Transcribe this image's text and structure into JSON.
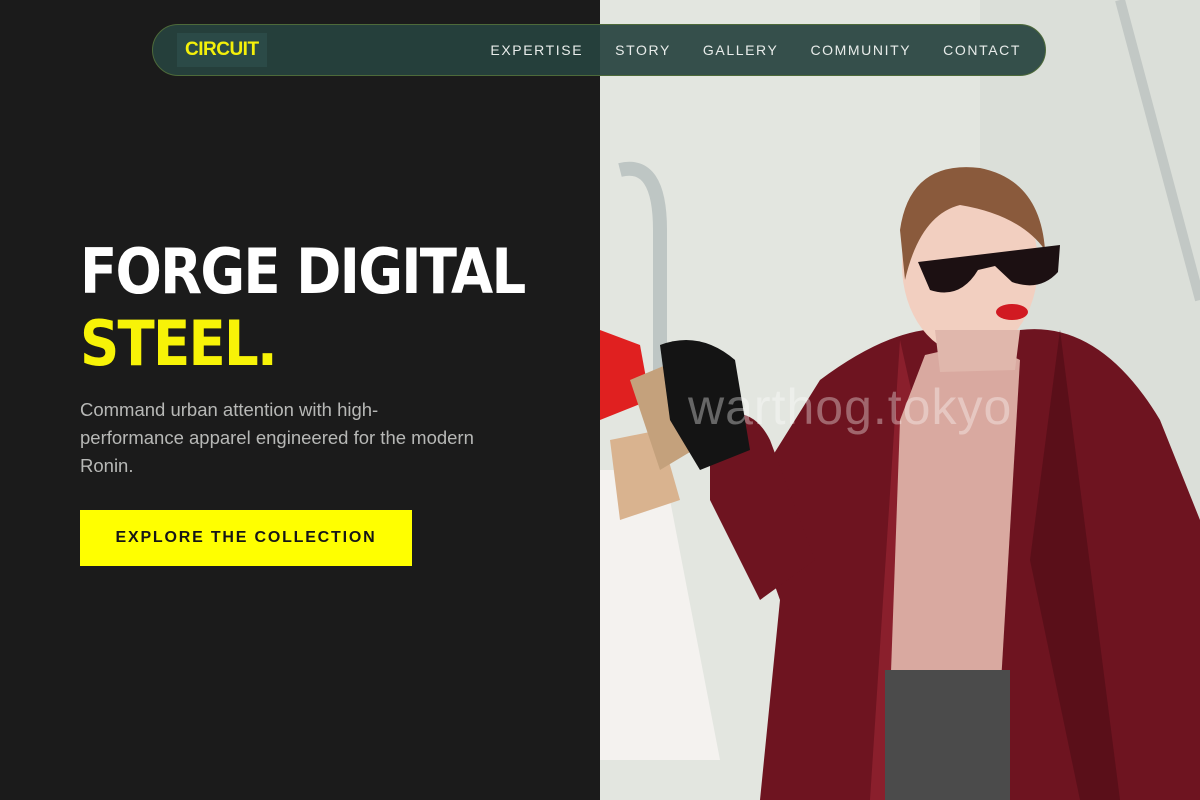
{
  "nav": {
    "logo": "CIRCUIT",
    "links": [
      "EXPERTISE",
      "STORY",
      "GALLERY",
      "COMMUNITY",
      "CONTACT"
    ]
  },
  "hero": {
    "title_line1": "FORGE DIGITAL",
    "title_line2": "STEEL.",
    "subtitle": "Command urban attention with high-performance apparel engineered for the modern Ronin.",
    "cta_label": "EXPLORE THE COLLECTION"
  },
  "image": {
    "watermark": "warthog.tokyo",
    "subject": "woman-in-sunglasses-carrying-shopping-bags"
  },
  "colors": {
    "accent": "#ffff00",
    "background": "#1b1b1b",
    "nav_bg": "#26423e",
    "text_muted": "#b7b8b6"
  }
}
